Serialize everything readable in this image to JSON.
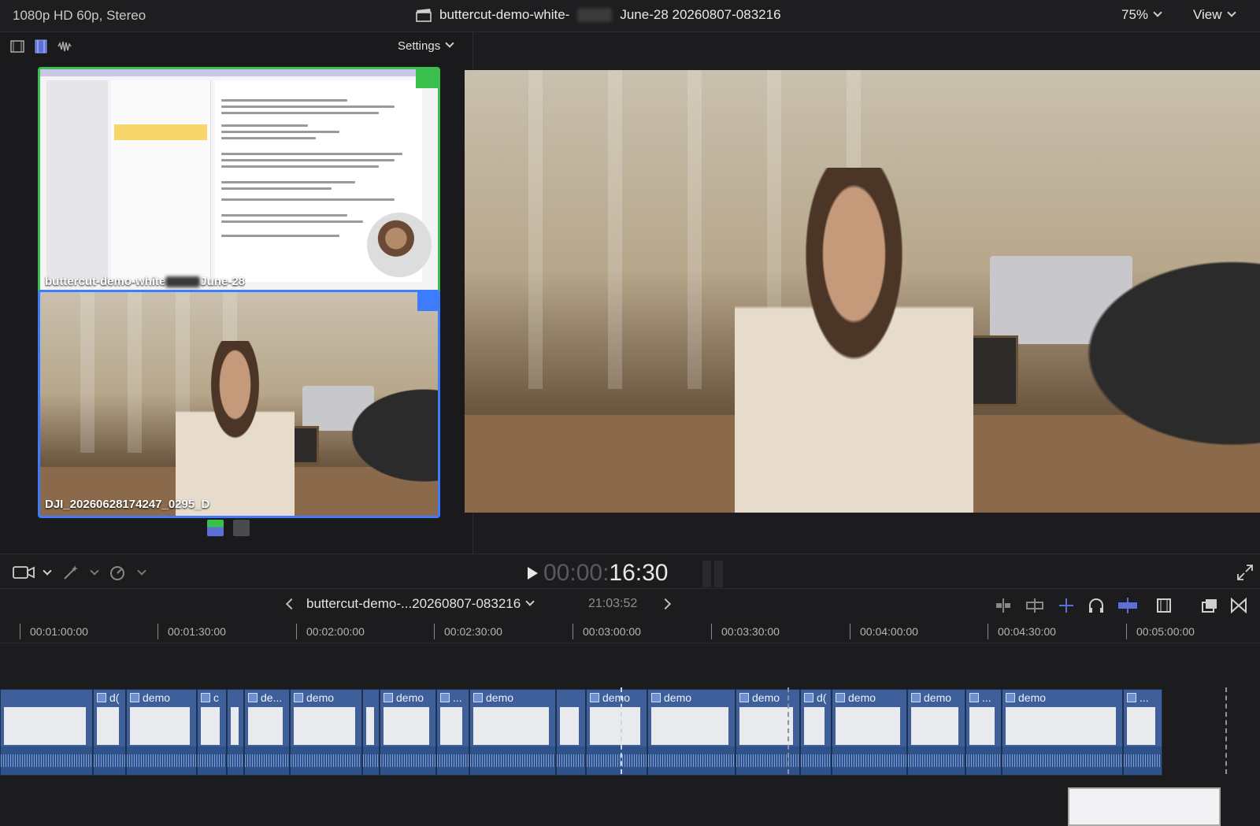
{
  "topbar": {
    "format": "1080p HD 60p, Stereo",
    "title_left": "buttercut-demo-white-",
    "title_right": "June-28 20260807-083216",
    "zoom": "75%",
    "view": "View"
  },
  "browser": {
    "settings": "Settings",
    "clips": [
      {
        "name_left": "buttercut-demo-white",
        "name_right": "June-28"
      },
      {
        "name": "DJI_20260628174247_0295_D"
      }
    ]
  },
  "transport": {
    "timecode_dim": "00:00:",
    "timecode": "16:30"
  },
  "timeline_bar": {
    "project": "buttercut-demo-...20260807-083216",
    "duration": "21:03:52"
  },
  "ruler": [
    "00:01:00:00",
    "00:01:30:00",
    "00:02:00:00",
    "00:02:30:00",
    "00:03:00:00",
    "00:03:30:00",
    "00:04:00:00",
    "00:04:30:00",
    "00:05:00:00"
  ],
  "timeline_clips": [
    {
      "label": ""
    },
    {
      "label": "d("
    },
    {
      "label": "demo"
    },
    {
      "label": "c"
    },
    {
      "label": ""
    },
    {
      "label": "de..."
    },
    {
      "label": "demo"
    },
    {
      "label": ""
    },
    {
      "label": "demo"
    },
    {
      "label": "..."
    },
    {
      "label": "demo"
    },
    {
      "label": ""
    },
    {
      "label": "demo"
    },
    {
      "label": "demo"
    },
    {
      "label": "demo"
    },
    {
      "label": "d("
    },
    {
      "label": "demo"
    },
    {
      "label": "demo"
    },
    {
      "label": "..."
    },
    {
      "label": "demo"
    },
    {
      "label": "..."
    }
  ],
  "colors": {
    "accent_green": "#3bc04d",
    "accent_blue": "#3d7bff",
    "clip_blue": "#3e5f9a"
  },
  "icons": [
    "clip-appearance-icon",
    "filmstrip-icon",
    "waveform-icon",
    "camera-icon",
    "magic-wand-icon",
    "speed-icon",
    "play-icon",
    "fullscreen-icon",
    "headphones-icon",
    "snapping-icon",
    "blade-icon"
  ]
}
